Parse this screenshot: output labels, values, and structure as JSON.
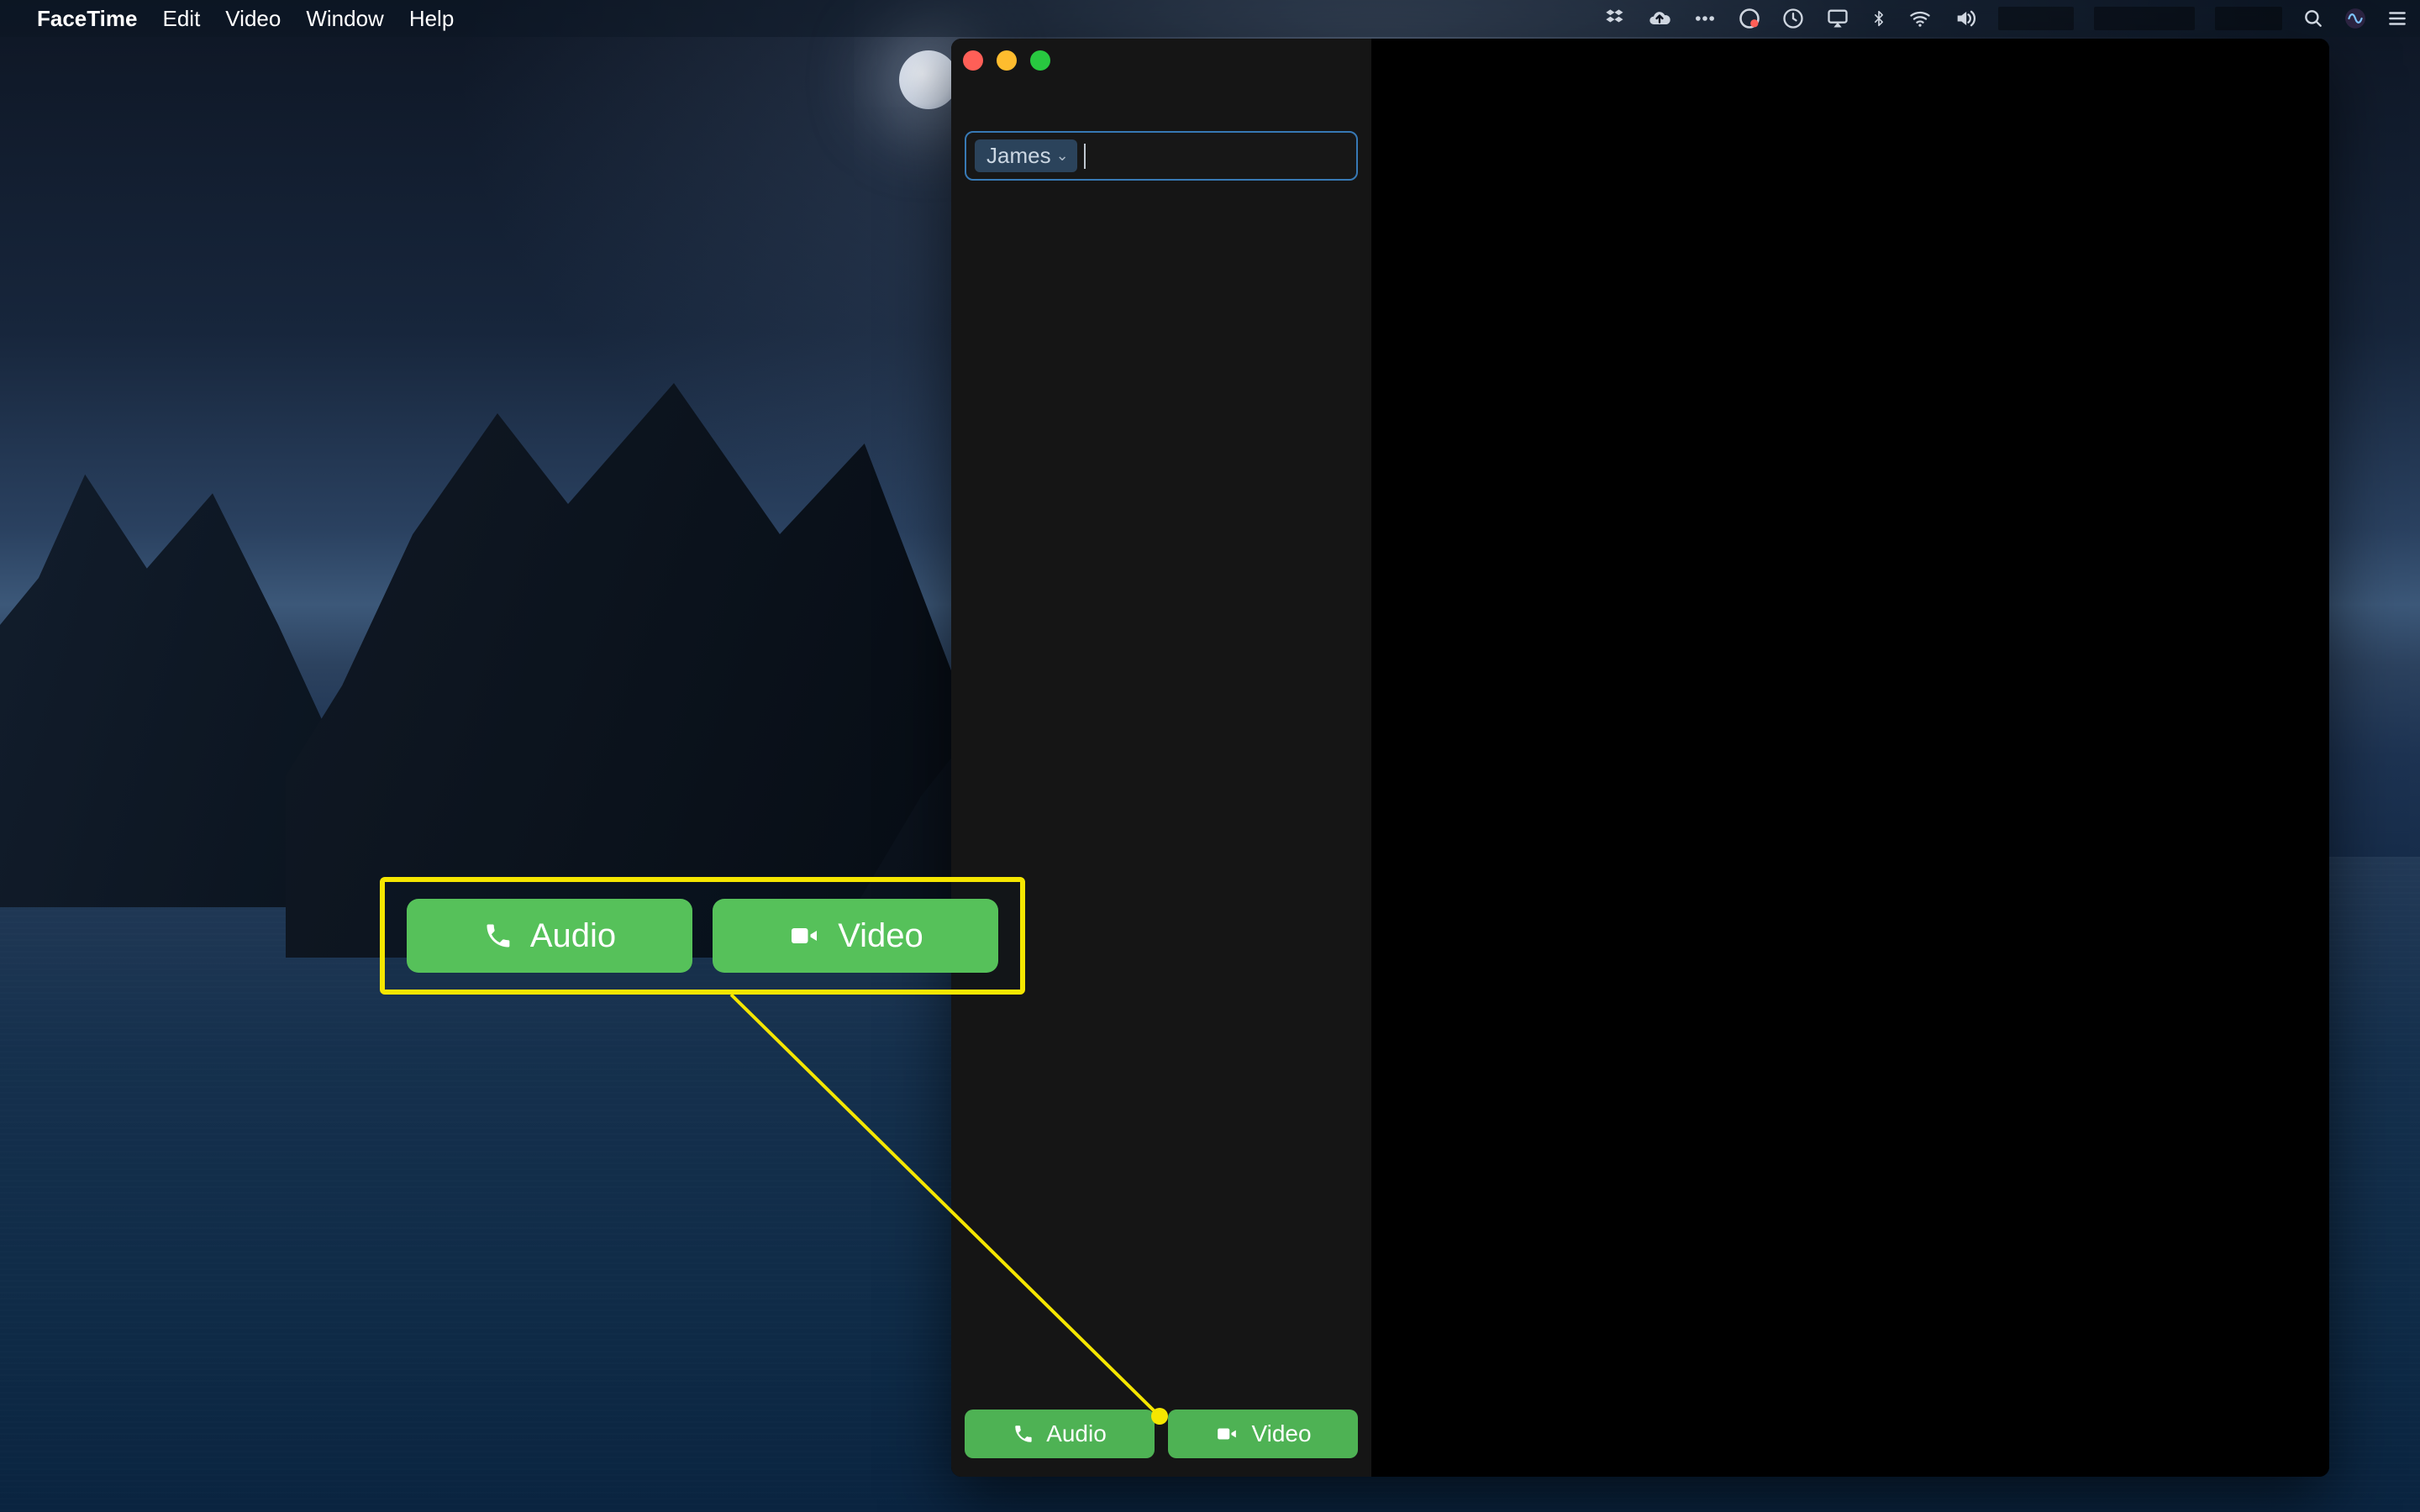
{
  "menubar": {
    "app": "FaceTime",
    "items": [
      "Edit",
      "Video",
      "Window",
      "Help"
    ]
  },
  "facetime": {
    "recipient_token": "James",
    "buttons": {
      "audio": "Audio",
      "video": "Video"
    }
  },
  "callout": {
    "audio": "Audio",
    "video": "Video"
  }
}
